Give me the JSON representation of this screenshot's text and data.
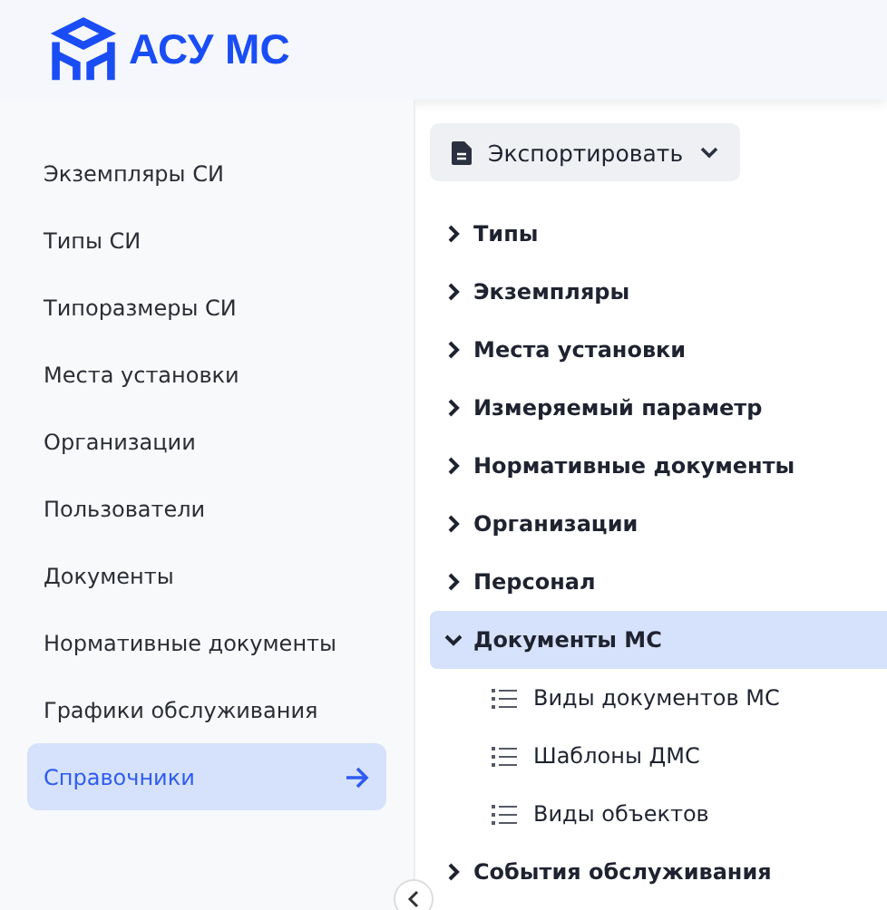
{
  "header": {
    "title": "АСУ МС"
  },
  "sidebar": {
    "items": [
      {
        "label": "Экземпляры СИ",
        "selected": false
      },
      {
        "label": "Типы СИ",
        "selected": false
      },
      {
        "label": "Типоразмеры СИ",
        "selected": false
      },
      {
        "label": "Места установки",
        "selected": false
      },
      {
        "label": "Организации",
        "selected": false
      },
      {
        "label": "Пользователи",
        "selected": false
      },
      {
        "label": "Документы",
        "selected": false
      },
      {
        "label": "Нормативные документы",
        "selected": false
      },
      {
        "label": "Графики обслуживания",
        "selected": false
      },
      {
        "label": "Справочники",
        "selected": true
      }
    ]
  },
  "export_button": {
    "label": "Экспортировать"
  },
  "tree": [
    {
      "label": "Типы",
      "expanded": false,
      "selected": false
    },
    {
      "label": "Экземпляры",
      "expanded": false,
      "selected": false
    },
    {
      "label": "Места установки",
      "expanded": false,
      "selected": false
    },
    {
      "label": "Измеряемый параметр",
      "expanded": false,
      "selected": false
    },
    {
      "label": "Нормативные документы",
      "expanded": false,
      "selected": false
    },
    {
      "label": "Организации",
      "expanded": false,
      "selected": false
    },
    {
      "label": "Персонал",
      "expanded": false,
      "selected": false
    },
    {
      "label": "Документы МС",
      "expanded": true,
      "selected": true,
      "children": [
        {
          "label": "Виды документов МС"
        },
        {
          "label": "Шаблоны ДМС"
        },
        {
          "label": "Виды объектов"
        }
      ]
    },
    {
      "label": "События обслуживания",
      "expanded": false,
      "selected": false
    }
  ]
}
